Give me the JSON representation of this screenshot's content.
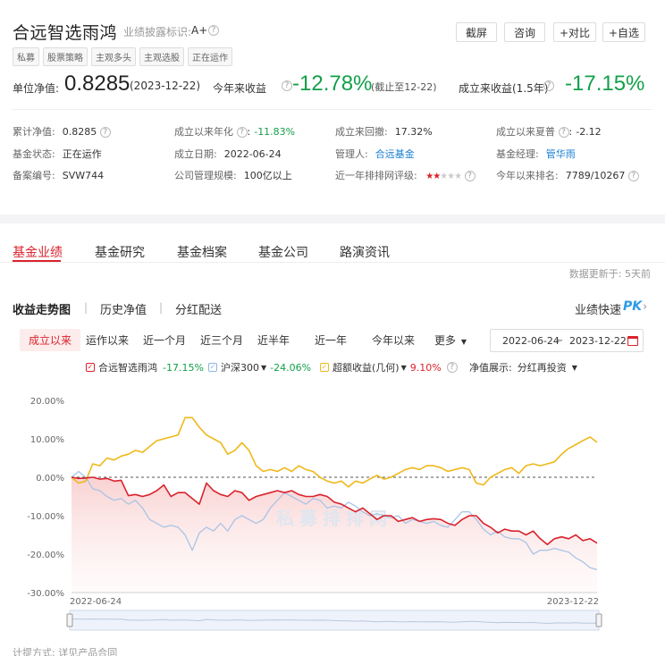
{
  "header": {
    "fund_name": "合远智选雨鸿",
    "disclosure_label": "业绩披露标识:",
    "disclosure_value": "A+",
    "buttons": [
      "截屏",
      "咨询",
      "+对比",
      "+自选"
    ],
    "tags": [
      "私募",
      "股票策略",
      "主观多头",
      "主观选股",
      "正在运作"
    ]
  },
  "metrics": {
    "nav_label": "单位净值:",
    "nav_value": "0.8285",
    "nav_date": "(2023-12-22)",
    "ytd_label": "今年来收益",
    "ytd_value": "-12.78%",
    "ytd_note": "(截止至12-22)",
    "si_label": "成立来收益(1.5年)",
    "si_value": "-17.15%"
  },
  "info": {
    "cum_nav_label": "累计净值:",
    "cum_nav_value": "0.8285",
    "annual_label": "成立以来年化",
    "annual_value": "-11.83%",
    "drawdown_label": "成立来回撤:",
    "drawdown_value": "17.32%",
    "sharpe_label": "成立以来夏普",
    "sharpe_value": "-2.12",
    "status_label": "基金状态:",
    "status_value": "正在运作",
    "inception_label": "成立日期:",
    "inception_value": "2022-06-24",
    "manager_co_label": "管理人:",
    "manager_co_value": "合远基金",
    "manager_label": "基金经理:",
    "manager_value": "管华雨",
    "record_label": "备案编号:",
    "record_value": "SVW744",
    "scale_label": "公司管理规模:",
    "scale_value": "100亿以上",
    "rating_label": "近一年排排网评级:",
    "rating_stars": 2,
    "rating_max": 5,
    "rank_label": "今年以来排名:",
    "rank_value": "7789/10267"
  },
  "tabs": [
    "基金业绩",
    "基金研究",
    "基金档案",
    "基金公司",
    "路演资讯"
  ],
  "update_note": "数据更新于: 5天前",
  "subtabs": [
    "收益走势图",
    "历史净值",
    "分红配送"
  ],
  "quick_label": "业绩快速",
  "pk_label": "PK",
  "ranges": [
    "成立以来",
    "运作以来",
    "近一个月",
    "近三个月",
    "近半年",
    "近一年",
    "今年以来"
  ],
  "more_label": "更多",
  "date_start": "2022-06-24",
  "date_end": "2023-12-22",
  "legend": {
    "fund_name": "合远智选雨鸿",
    "fund_value": "-17.15%",
    "index_name": "沪深300",
    "index_value": "-24.06%",
    "excess_name": "超额收益(几何)",
    "excess_value": "9.10%",
    "nav_display_label": "净值展示:",
    "nav_display_value": "分红再投资"
  },
  "colors": {
    "fund": "#d9232d",
    "index": "#a8c4e6",
    "excess": "#efb81a",
    "positive": "#d9232d",
    "negative": "#13a04a"
  },
  "calc_note": "计提方式: 详见产品合同",
  "chart_data": {
    "type": "line",
    "x_start": "2022-06-24",
    "x_end": "2023-12-22",
    "x_tick_labels": [
      "2022-06-24",
      "2023-12-22"
    ],
    "y_ticks": [
      20,
      10,
      0,
      -10,
      -20,
      -30
    ],
    "y_tick_labels": [
      "20.00%",
      "10.00%",
      "0.00%",
      "-10.00%",
      "-20.00%",
      "-30.00%"
    ],
    "ylim": [
      -30,
      20
    ],
    "series": [
      {
        "name": "合远智选雨鸿",
        "values": [
          0,
          -0.3,
          -0.2,
          0,
          -0.5,
          -0.3,
          -1,
          -0.8,
          -4.8,
          -4.5,
          -5,
          -4.5,
          -3.5,
          -2,
          -5,
          -4,
          -4,
          -5.5,
          -7,
          -1.5,
          -3.5,
          -4.5,
          -5,
          -3.5,
          -4,
          -6,
          -5,
          -4.5,
          -4,
          -3.5,
          -4,
          -3.5,
          -4.5,
          -5,
          -5,
          -4.5,
          -5,
          -6.5,
          -7,
          -8,
          -9,
          -8,
          -9.5,
          -11,
          -10,
          -10,
          -11.5,
          -11,
          -10.5,
          -11.5,
          -11,
          -10.8,
          -11,
          -12,
          -12.5,
          -11,
          -10,
          -10,
          -12,
          -13,
          -14.5,
          -13.5,
          -14,
          -14,
          -15,
          -14,
          -16,
          -17.5,
          -16,
          -15.5,
          -16,
          -15,
          -16.5,
          -16,
          -17.15
        ]
      },
      {
        "name": "沪深300",
        "values": [
          0,
          1.5,
          0,
          -3,
          -3.5,
          -5,
          -6,
          -5.5,
          -7,
          -6,
          -8,
          -11,
          -12,
          -13,
          -12.5,
          -13,
          -15,
          -19,
          -14.5,
          -13,
          -14,
          -12,
          -14,
          -11,
          -10,
          -11,
          -12,
          -11,
          -8,
          -6,
          -4,
          -5,
          -6,
          -7,
          -5.5,
          -6,
          -8,
          -7.5,
          -8,
          -6.5,
          -7.5,
          -9,
          -10,
          -9.5,
          -10,
          -10.5,
          -10,
          -12,
          -11,
          -11.5,
          -12,
          -11.5,
          -12.5,
          -13,
          -11,
          -9,
          -9,
          -11,
          -13.5,
          -15,
          -14,
          -15.5,
          -16,
          -16,
          -17,
          -20,
          -19,
          -19,
          -18.5,
          -19,
          -19.5,
          -21,
          -22,
          -23.5,
          -24.06
        ]
      },
      {
        "name": "超额收益(几何)",
        "values": [
          0,
          -1.5,
          -1,
          3.5,
          3,
          5,
          4.5,
          5.5,
          6,
          7,
          6.5,
          8,
          9.5,
          10,
          10.5,
          11,
          15.5,
          15.5,
          13,
          11,
          10,
          9,
          6,
          7,
          9,
          7,
          3,
          1.5,
          2,
          1.5,
          2.5,
          1.5,
          3,
          2,
          1.5,
          0,
          -1,
          -1.5,
          -1,
          -2.5,
          -1,
          -1.5,
          -0.5,
          0.5,
          -0.5,
          0,
          1,
          2,
          2.5,
          2,
          3,
          3,
          2.5,
          1.5,
          2,
          2.5,
          2,
          -1.5,
          -2,
          0,
          1,
          2,
          2.5,
          1,
          3,
          3.5,
          3,
          3.5,
          4,
          6,
          7.5,
          8.5,
          9.5,
          10.5,
          9.1
        ]
      }
    ]
  }
}
